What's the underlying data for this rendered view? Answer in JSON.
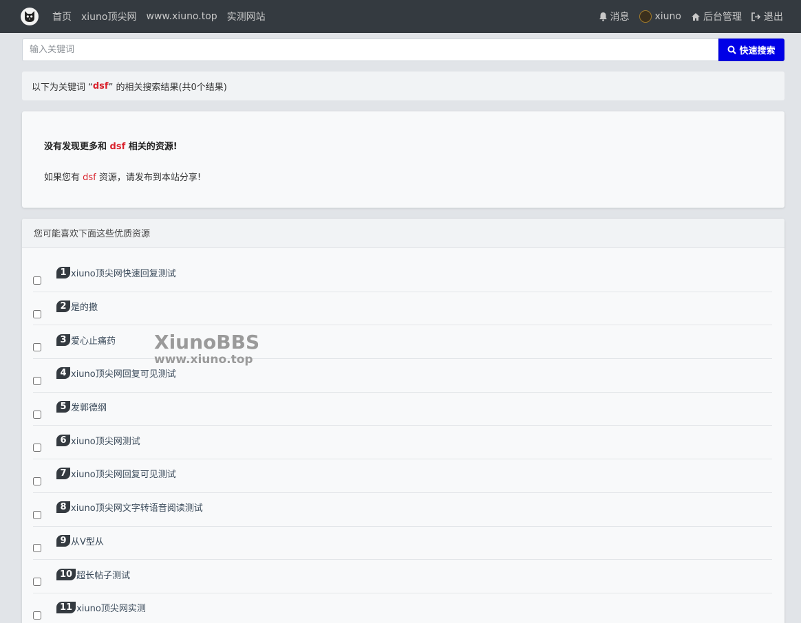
{
  "nav": {
    "links": [
      "首页",
      "xiuno顶尖网",
      "www.xiuno.top",
      "实测网站"
    ],
    "messages": "消息",
    "user": "xiuno",
    "admin": "后台管理",
    "logout": "退出"
  },
  "search": {
    "placeholder": "输入关键词",
    "button": "快速搜索"
  },
  "result": {
    "prefix": "以下为关键词 “",
    "keyword": "dsf",
    "suffix": "” 的相关搜索结果(共0个结果)"
  },
  "empty": {
    "line1_prefix": "没有发现更多和 ",
    "keyword": "dsf",
    "line1_suffix": " 相关的资源!",
    "line2_prefix": "如果您有 ",
    "line2_suffix": " 资源，请发布到本站分享!"
  },
  "recommend": {
    "title": "您可能喜欢下面这些优质资源",
    "items": [
      {
        "num": "1",
        "title": "xiuno顶尖网快速回复测试"
      },
      {
        "num": "2",
        "title": "是的撒"
      },
      {
        "num": "3",
        "title": "爱心止痛药"
      },
      {
        "num": "4",
        "title": "xiuno顶尖网回复可见测试"
      },
      {
        "num": "5",
        "title": "发郭德纲"
      },
      {
        "num": "6",
        "title": "xiuno顶尖网测试"
      },
      {
        "num": "7",
        "title": "xiuno顶尖网回复可见测试"
      },
      {
        "num": "8",
        "title": "xiuno顶尖网文字转语音阅读测试"
      },
      {
        "num": "9",
        "title": "从V型从"
      },
      {
        "num": "10",
        "title": "超长帖子测试"
      },
      {
        "num": "11",
        "title": "xiuno顶尖网实测"
      }
    ]
  },
  "watermark": {
    "line1": "XiunoBBS",
    "line2": "www.xiuno.top"
  }
}
